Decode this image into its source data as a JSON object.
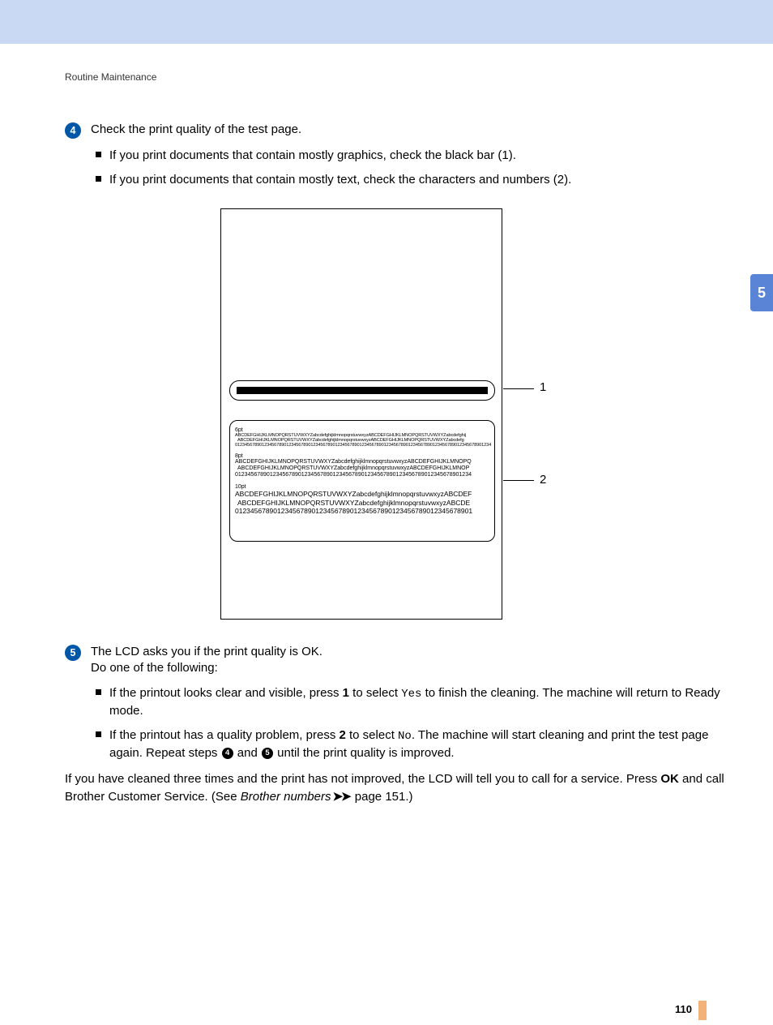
{
  "header": {
    "section": "Routine Maintenance"
  },
  "chapter_tab": "5",
  "page_number": "110",
  "steps": {
    "s4": {
      "number": "4",
      "text": "Check the print quality of the test page.",
      "bullets": [
        "If you print documents that contain mostly graphics, check the black bar (1).",
        "If you print documents that contain mostly text, check the characters and numbers (2)."
      ]
    },
    "s5": {
      "number": "5",
      "line1": "The LCD asks you if the print quality is OK.",
      "line2": "Do one of the following:",
      "bullet1_a": "If the printout looks clear and visible, press ",
      "bullet1_b": "1",
      "bullet1_c": " to select ",
      "bullet1_yes": "Yes",
      "bullet1_d": " to finish the cleaning. The machine will return to Ready mode.",
      "bullet2_a": "If the printout has a quality problem, press ",
      "bullet2_b": "2",
      "bullet2_c": " to select ",
      "bullet2_no": "No",
      "bullet2_d": ". The machine will start cleaning and print the test page again. Repeat steps ",
      "bullet2_ref1": "4",
      "bullet2_mid": " and ",
      "bullet2_ref2": "5",
      "bullet2_e": " until the print quality is improved."
    }
  },
  "closing": {
    "part1": "If you have cleaned three times and the print has not improved, the LCD will tell you to call for a service. Press ",
    "ok": "OK",
    "part2": " and call Brother Customer Service. (See ",
    "link": "Brother numbers",
    "part3": " page 151.)"
  },
  "callouts": {
    "one": "1",
    "two": "2"
  },
  "testpage": {
    "l6": "6pt",
    "l6a": "ABCDEFGHIJKLMNOPQRSTUVWXYZabcdefghijklmnopqrstuvwxyzABCDEFGHIJKLMNOPQRSTUVWXYZabcdefghij",
    "l6b": "ABCDEFGHIJKLMNOPQRSTUVWXYZabcdefghijklmnopqrstuvwxyzABCDEFGHIJKLMNOPQRSTUVWXYZabcdefg",
    "l6c": "012345678901234567890123456789012345678901234567890123456789012345678901234567890123456789012345678901234",
    "l8": "8pt",
    "l8a": "ABCDEFGHIJKLMNOPQRSTUVWXYZabcdefghijklmnopqrstuvwxyzABCDEFGHIJKLMNOPQ",
    "l8b": "ABCDEFGHIJKLMNOPQRSTUVWXYZabcdefghijklmnopqrstuvwxyzABCDEFGHIJKLMNOP",
    "l8c": "012345678901234567890123456789012345678901234567890123456789012345678901234",
    "l10": "10pt",
    "l10a": "ABCDEFGHIJKLMNOPQRSTUVWXYZabcdefghijklmnopqrstuvwxyzABCDEF",
    "l10b": "ABCDEFGHIJKLMNOPQRSTUVWXYZabcdefghijklmnopqrstuvwxyzABCDE",
    "l10c": "01234567890123456789012345678901234567890123456789012345678901"
  }
}
